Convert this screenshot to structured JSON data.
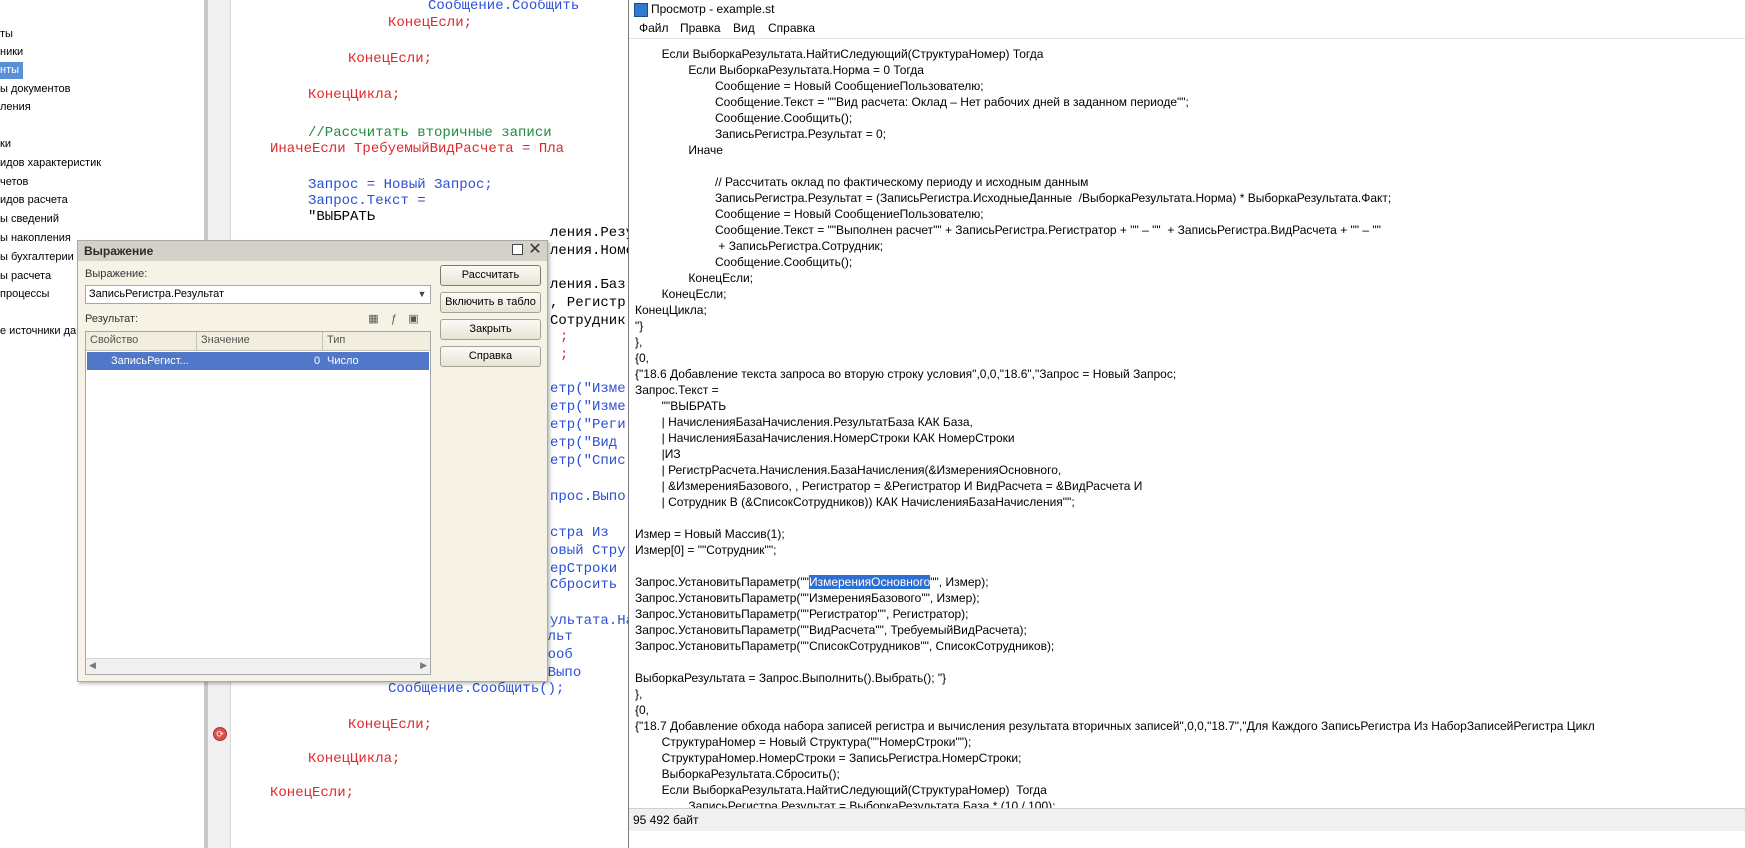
{
  "left_tree": {
    "items": [
      {
        "label": "ты"
      },
      {
        "label": "ники"
      },
      {
        "label": "нты"
      },
      {
        "label": "ы документов"
      },
      {
        "label": "ления"
      },
      {
        "label": ""
      },
      {
        "label": "ки"
      },
      {
        "label": "идов характеристик"
      },
      {
        "label": "четов"
      },
      {
        "label": "идов расчета"
      },
      {
        "label": "ы сведений"
      },
      {
        "label": "ы накопления"
      },
      {
        "label": "ы бухгалтерии"
      },
      {
        "label": "ы расчета"
      },
      {
        "label": "процессы"
      },
      {
        "label": ""
      },
      {
        "label": "е источники да"
      }
    ]
  },
  "code_editor": {
    "lines": [
      {
        "text": "Сообщение.Сообщить"
      },
      {
        "text": "КонецЕсли;"
      },
      {
        "text": ""
      },
      {
        "text": "КонецЕсли;"
      },
      {
        "text": ""
      },
      {
        "text": "КонецЦикла;"
      },
      {
        "text": ""
      },
      {
        "text": "//Рассчитать вторичные записи"
      },
      {
        "text": "ИначеЕсли ТребуемыйВидРасчета = Пла"
      },
      {
        "text": ""
      },
      {
        "text": "Запрос = Новый Запрос;"
      },
      {
        "text": "Запрос.Текст ="
      },
      {
        "text": "\"ВЫБРАТЬ"
      },
      {
        "text": "ления.Резу"
      },
      {
        "text": "ления.Номе"
      },
      {
        "text": ""
      },
      {
        "text": "ления.Баз"
      },
      {
        "text": ", Регистр"
      },
      {
        "text": "Сотрудник"
      },
      {
        "text": ";"
      },
      {
        "text": ";"
      },
      {
        "text": ""
      },
      {
        "text": "етр(\"Изме"
      },
      {
        "text": "етр(\"Изме"
      },
      {
        "text": "етр(\"Реги"
      },
      {
        "text": "етр(\"Вид"
      },
      {
        "text": "етр(\"Спис"
      },
      {
        "text": ""
      },
      {
        "text": "прос.Выпо"
      },
      {
        "text": ""
      },
      {
        "text": "стра Из"
      },
      {
        "text": "овый Стру"
      },
      {
        "text": "ерСтроки"
      },
      {
        "text": "Сбросить"
      },
      {
        "text": ""
      },
      {
        "text": "ультата.Найт"
      },
      {
        "text": "ЗаписьРегистра.Результ"
      },
      {
        "text": "Сообщение = Новый Сооб"
      },
      {
        "text": "Сообщение.Текст = \"Выпо"
      },
      {
        "text": "Сообщение.Сообщить();"
      },
      {
        "text": ""
      },
      {
        "text": "КонецЕсли;"
      },
      {
        "text": ""
      },
      {
        "text": "КонецЦикла;"
      },
      {
        "text": ""
      },
      {
        "text": "КонецЕсли;"
      }
    ]
  },
  "viewer": {
    "title": "Просмотр - example.st",
    "menu": [
      {
        "label": "Файл"
      },
      {
        "label": "Правка"
      },
      {
        "label": "Вид"
      },
      {
        "label": "Справка"
      }
    ],
    "lines": [
      {
        "text": "        Если ВыборкаРезультата.НайтиСледующий(СтруктураНомер) Тогда"
      },
      {
        "text": "                Если ВыборкаРезультата.Норма = 0 Тогда"
      },
      {
        "text": "                        Сообщение = Новый СообщениеПользователю;"
      },
      {
        "text": "                        Сообщение.Текст = \"\"Вид расчета: Оклад – Нет рабочих дней в заданном периоде\"\";"
      },
      {
        "text": "                        Сообщение.Сообщить();"
      },
      {
        "text": "                        ЗаписьРегистра.Результат = 0;"
      },
      {
        "text": "                Иначе"
      },
      {
        "text": ""
      },
      {
        "text": "                        // Рассчитать оклад по фактическому периоду и исходным данным"
      },
      {
        "text": "                        ЗаписьРегистра.Результат = (ЗаписьРегистра.ИсходныеДанные  /ВыборкаРезультата.Норма) * ВыборкаРезультата.Факт;"
      },
      {
        "text": "                        Сообщение = Новый СообщениеПользователю;"
      },
      {
        "text": "                        Сообщение.Текст = \"\"Выполнен расчет\"\" + ЗаписьРегистра.Регистратор + \"\" – \"\"  + ЗаписьРегистра.ВидРасчета + \"\" – \"\""
      },
      {
        "text": "                         + ЗаписьРегистра.Сотрудник;"
      },
      {
        "text": "                        Сообщение.Сообщить();"
      },
      {
        "text": "                КонецЕсли;"
      },
      {
        "text": "        КонецЕсли;"
      },
      {
        "text": "КонецЦикла;"
      },
      {
        "text": "\"}"
      },
      {
        "text": "},"
      },
      {
        "text": "{0,"
      },
      {
        "text": "{\"18.6 Добавление текста запроса во вторую строку условия\",0,0,\"18.6\",\"Запрос = Новый Запрос;"
      },
      {
        "text": "Запрос.Текст ="
      },
      {
        "text": "        \"\"ВЫБРАТЬ"
      },
      {
        "text": "        | НачисленияБазаНачисления.РезультатБаза КАК База,"
      },
      {
        "text": "        | НачисленияБазаНачисления.НомерСтроки КАК НомерСтроки"
      },
      {
        "text": "        |ИЗ"
      },
      {
        "text": "        | РегистрРасчета.Начисления.БазаНачисления(&ИзмеренияОсновного,"
      },
      {
        "text": "        | &ИзмеренияБазового, , Регистратор = &Регистратор И ВидРасчета = &ВидРасчета И"
      },
      {
        "text": "        | Сотрудник В (&СписокСотрудников)) КАК НачисленияБазаНачисления\"\";"
      },
      {
        "text": ""
      },
      {
        "text": "Измер = Новый Массив(1);"
      },
      {
        "text": "Измер[0] = \"\"Сотрудник\"\";"
      },
      {
        "text": ""
      },
      {
        "text": "Запрос.УстановитьПараметр(\"\"",
        "selected": "ИзмеренияОсновного",
        "after": "\"\", Измер);"
      },
      {
        "text": "Запрос.УстановитьПараметр(\"\"ИзмеренияБазового\"\", Измер);"
      },
      {
        "text": "Запрос.УстановитьПараметр(\"\"Регистратор\"\", Регистратор);"
      },
      {
        "text": "Запрос.УстановитьПараметр(\"\"ВидРасчета\"\", ТребуемыйВидРасчета);"
      },
      {
        "text": "Запрос.УстановитьПараметр(\"\"СписокСотрудников\"\", СписокСотрудников);"
      },
      {
        "text": ""
      },
      {
        "text": "ВыборкаРезультата = Запрос.Выполнить().Выбрать(); \"}"
      },
      {
        "text": "},"
      },
      {
        "text": "{0,"
      },
      {
        "text": "{\"18.7 Добавление обхода набора записей регистра и вычисления результата вторичных записей\",0,0,\"18.7\",\"Для Каждого ЗаписьРегистра Из НаборЗаписейРегистра Цикл"
      },
      {
        "text": "        СтруктураНомер = Новый Структура(\"\"НомерСтроки\"\");"
      },
      {
        "text": "        СтруктураНомер.НомерСтроки = ЗаписьРегистра.НомерСтроки;"
      },
      {
        "text": "        ВыборкаРезультата.Сбросить();"
      },
      {
        "text": "        Если ВыборкаРезультата.НайтиСледующий(СтруктураНомер)  Тогда"
      },
      {
        "text": "                ЗаписьРегистра.Результат = ВыборкаРезультата.База * (10 / 100);"
      }
    ],
    "status": "95 492 байт"
  },
  "dialog": {
    "title": "Выражение",
    "expression_label": "Выражение:",
    "expression_value": "ЗаписьРегистра.Результат",
    "result_label": "Результат:",
    "buttons": {
      "calculate": "Рассчитать",
      "include_table": "Включить в табло",
      "close": "Закрыть",
      "help": "Справка"
    },
    "table": {
      "headers": [
        "Свойство",
        "Значение",
        "Тип"
      ],
      "rows": [
        {
          "property": "ЗаписьРегист...",
          "value": "0",
          "type": "Число"
        }
      ]
    }
  }
}
